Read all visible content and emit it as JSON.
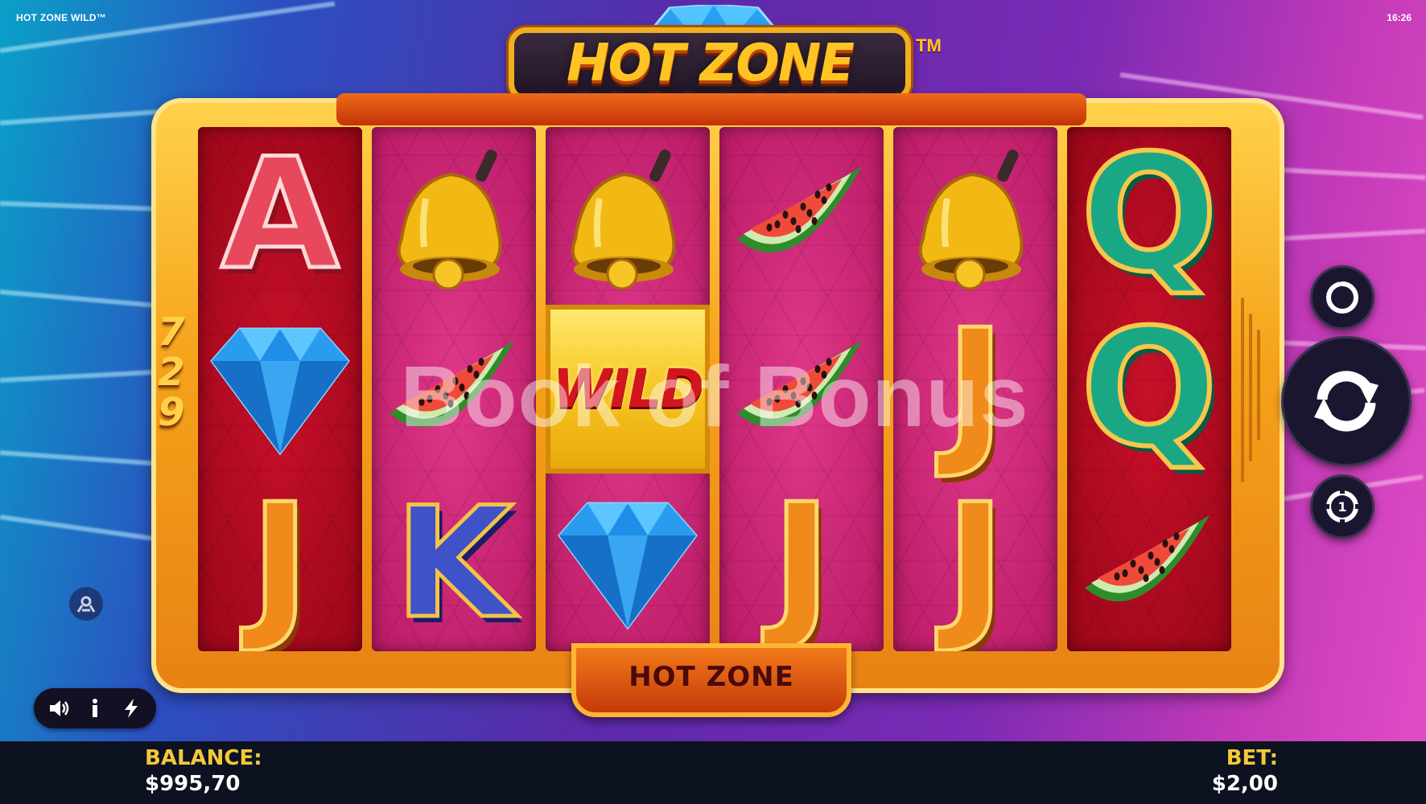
{
  "game": {
    "title_bar": "HOT ZONE WILD™",
    "clock": "16:26",
    "logo_text": "HOT ZONE WILD",
    "logo_tm": "TM",
    "ways_digits": [
      "7",
      "2",
      "9"
    ],
    "hot_zone_label": "HOT ZONE",
    "wild_label": "WILD",
    "watermark": "Book of Bonus"
  },
  "reels": [
    {
      "color": "red",
      "symbols": [
        "A",
        "diamond",
        "J"
      ]
    },
    {
      "color": "pink",
      "symbols": [
        "bell",
        "watermelon",
        "K"
      ]
    },
    {
      "color": "pink",
      "symbols": [
        "bell",
        "wild",
        "diamond"
      ]
    },
    {
      "color": "pink",
      "symbols": [
        "watermelon",
        "watermelon",
        "J"
      ]
    },
    {
      "color": "pink",
      "symbols": [
        "bell",
        "J",
        "J"
      ]
    },
    {
      "color": "red",
      "symbols": [
        "Q",
        "Q",
        "watermelon"
      ]
    }
  ],
  "controls": {
    "autoplay_icon": "autoplay-icon",
    "spin_icon": "spin-icon",
    "bet_icon": "bet-chip-icon",
    "bet_chip_value": "1",
    "settings_icon": "settings-icon",
    "sound_icon": "sound-icon",
    "info_icon": "info-icon",
    "turbo_icon": "lightning-icon"
  },
  "footer": {
    "balance_label": "BALANCE:",
    "balance_value": "$995,70",
    "bet_label": "BET:",
    "bet_value": "$2,00"
  },
  "colors": {
    "reel_red": "#b00a20",
    "reel_pink": "#c8247a",
    "frame_gold": "#f5a21a",
    "footer_label": "#f5c83a"
  }
}
